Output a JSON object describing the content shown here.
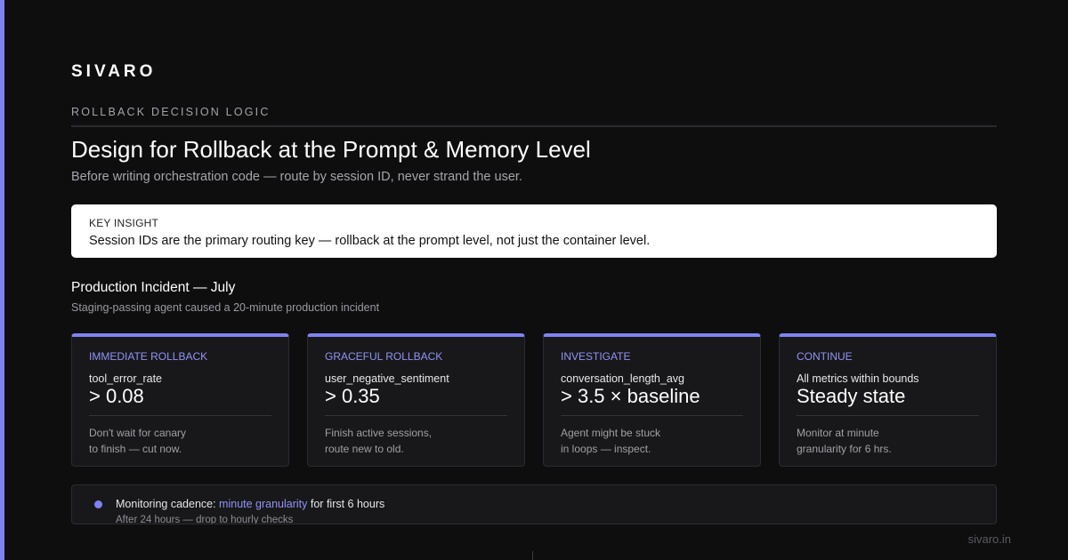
{
  "brand": "SIVARO",
  "eyebrow": "ROLLBACK DECISION LOGIC",
  "title": "Design for Rollback at the Prompt & Memory Level",
  "subtitle": "Before writing orchestration code — route by session ID, never strand the user.",
  "insight": {
    "label": "KEY INSIGHT",
    "text": "Session IDs are the primary routing key — rollback at the prompt level, not just the container level."
  },
  "section": {
    "title": "Production Incident — July",
    "subtitle": "Staging-passing agent caused a 20-minute production incident"
  },
  "cards": [
    {
      "label": "IMMEDIATE ROLLBACK",
      "metric": "tool_error_rate",
      "value": "> 0.08",
      "note_line1": "Don't wait for canary",
      "note_line2": "to finish — cut now."
    },
    {
      "label": "GRACEFUL ROLLBACK",
      "metric": "user_negative_sentiment",
      "value": "> 0.35",
      "note_line1": "Finish active sessions,",
      "note_line2": "route new to old."
    },
    {
      "label": "INVESTIGATE",
      "metric": "conversation_length_avg",
      "value": "> 3.5 × baseline",
      "note_line1": "Agent might be stuck",
      "note_line2": "in loops — inspect."
    },
    {
      "label": "CONTINUE",
      "metric": "All metrics within bounds",
      "value": "Steady state",
      "note_line1": "Monitor at minute",
      "note_line2": "granularity for 6 hrs."
    }
  ],
  "monitoring": {
    "prefix": "Monitoring cadence: ",
    "highlight": "minute granularity",
    "suffix": " for first 6 hours",
    "sub": "After 24 hours — drop to hourly checks"
  },
  "footer": "sivaro.in",
  "colors": {
    "accent": "#8082f2",
    "background": "#0e0e0f",
    "card": "#18181a"
  }
}
